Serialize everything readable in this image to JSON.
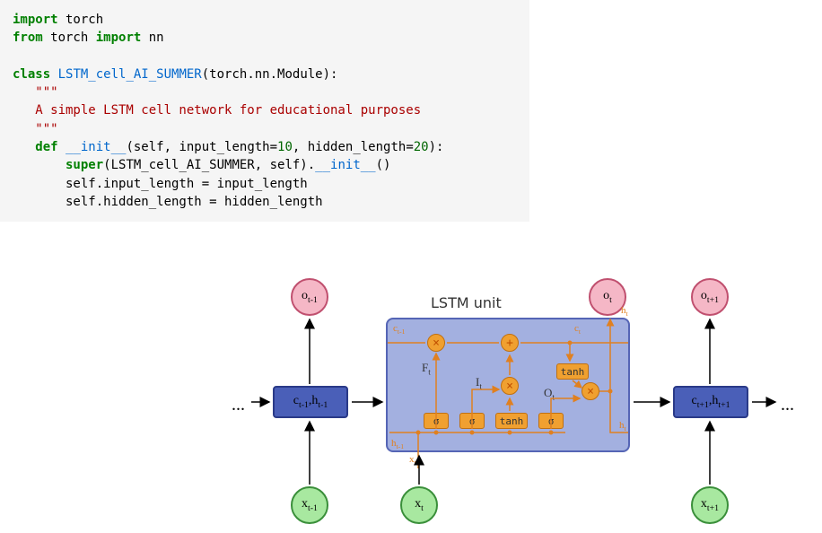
{
  "code": {
    "l1a": "import",
    "l1b": " torch",
    "l2a": "from",
    "l2b": " torch ",
    "l2c": "import",
    "l2d": " nn",
    "l4a": "class",
    "l4b": " ",
    "l4c": "LSTM_cell_AI_SUMMER",
    "l4d": "(torch.nn.Module):",
    "l5": "   \"\"\"",
    "l6": "   A simple LSTM cell network for educational purposes",
    "l7": "   \"\"\"",
    "l8a": "   def",
    "l8b": " ",
    "l8c": "__init__",
    "l8d": "(self, input_length=",
    "l8e": "10",
    "l8f": ", hidden_length=",
    "l8g": "20",
    "l8h": "):",
    "l9a": "       super",
    "l9b": "(LSTM_cell_AI_SUMMER, self).",
    "l9c": "__init__",
    "l9d": "()",
    "l10": "       self.input_length = input_length",
    "l11": "       self.hidden_length = hidden_length"
  },
  "diagram": {
    "title": "LSTM unit",
    "outputs": {
      "prev": "o",
      "prev_sub": "t-1",
      "cur": "o",
      "cur_sub": "t",
      "next": "o",
      "next_sub": "t+1"
    },
    "inputs": {
      "prev": "x",
      "prev_sub": "t-1",
      "cur": "x",
      "cur_sub": "t",
      "next": "x",
      "next_sub": "t+1"
    },
    "state_prev_c": "c",
    "state_prev_c_sub": "t-1",
    "state_prev_h": "h",
    "state_prev_h_sub": "t-1",
    "state_next_c": "c",
    "state_next_c_sub": "t+1",
    "state_next_h": "h",
    "state_next_h_sub": "t+1",
    "gates": {
      "sigma": "σ",
      "tanh": "tanh"
    },
    "labels": {
      "F": "F",
      "F_sub": "t",
      "I": "I",
      "I_sub": "t",
      "O": "O",
      "O_sub": "t",
      "c_prev": "c",
      "c_prev_sub": "t-1",
      "c_cur": "c",
      "c_cur_sub": "t",
      "h_prev": "h",
      "h_prev_sub": "t-1",
      "h_cur": "h",
      "h_cur_sub": "t",
      "x": "x",
      "x_sub": "t"
    },
    "ops": {
      "mult": "×",
      "add": "+"
    },
    "ellipsis": "..."
  }
}
